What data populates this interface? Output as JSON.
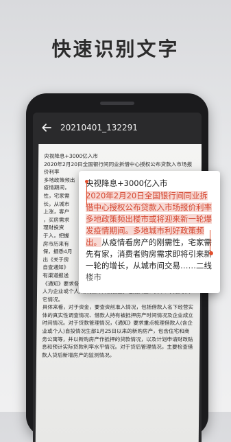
{
  "headline": "快速识别文字",
  "topbar": {
    "file_name": "20210401_132291"
  },
  "document": {
    "paragraphs": [
      "央视降息+3000亿入市",
      "2020年2月20日全国银行间同业拆借中心授权公布贷款入市场报价利率",
      "多地政策频出",
      "疫情期间，",
      "性，宅家需",
      "长，从城市",
      "上涨，客户",
      "，买房需求",
      "理财投资",
      "于入，把握",
      "房市历来有",
      "保，据悉4月",
      "出《关于房",
      "自查通知》",
      "有渠道报送",
      "《通知》要求各商业银行对今年以来新发放的房抵经营贷(含借款人为企业或个人)情况立即开展自查，包括资金、贷中、贷后等其它情况。",
      "具体来看，对于资金，要查资前准入情况，包括借款人名下经营实体的真实性调查情况、借款人持有被抵押房产时间情况及企业成立时间情况。对于贷款管理情况，《通知》要求重点梳理借款人(含企业或个人)自投情况生部1月25日以来的新购房产，包含住宅和商务公寓等，并以新购房产作抵押的贷款情况，以及计划申请财政贴息和预计实际贷款利率水平情况。对于贷后管理情况，主要检查借款人贷后新增房产的监测情况。"
    ]
  },
  "popup": {
    "line1": "央视降息+3000亿入市",
    "highlight": "2020年2月20日全国银行间同业拆借中心授权公布贷款入市场报价利率多地政策频出楼市或将迎来新一轮爆发疫情期间。多地城市利好政策频出。",
    "rest": "从疫情看房产的刚需性，宅家需先有家，消费者购房需求即将引来新一轮的增长，从城市间交易……二线楼市"
  }
}
